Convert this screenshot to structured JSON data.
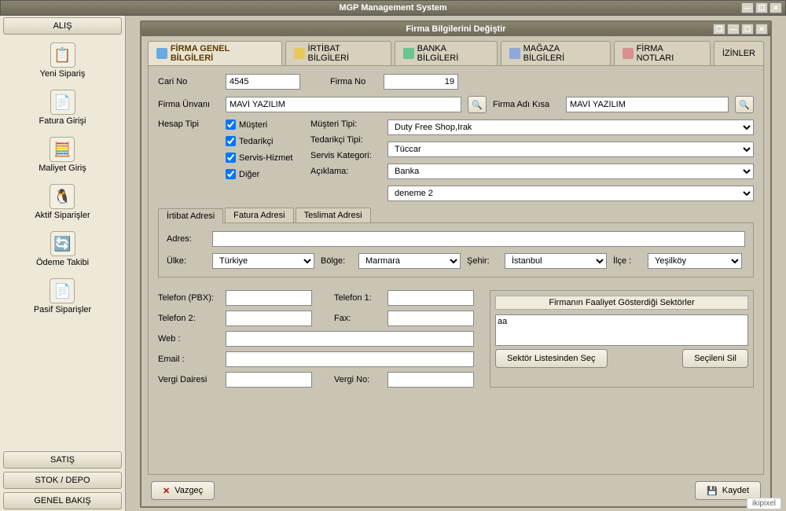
{
  "app": {
    "title": "MGP Management System"
  },
  "sidebar": {
    "sections": [
      "ALIŞ",
      "SATIŞ",
      "STOK / DEPO",
      "GENEL BAKIŞ"
    ],
    "items": [
      {
        "icon": "📋",
        "label": "Yeni Sipariş"
      },
      {
        "icon": "📄",
        "label": "Fatura Girişi"
      },
      {
        "icon": "🧮",
        "label": "Maliyet Giriş"
      },
      {
        "icon": "🐧",
        "label": "Aktif Siparişler"
      },
      {
        "icon": "🔄",
        "label": "Ödeme Takibi"
      },
      {
        "icon": "📄",
        "label": "Pasif Siparişler"
      }
    ]
  },
  "dialog": {
    "title": "Firma Bilgilerini Değiştir",
    "tabs": [
      "FİRMA GENEL BİLGİLERİ",
      "İRTİBAT BİLGİLERİ",
      "BANKA BİLGİLERİ",
      "MAĞAZA BİLGİLERİ",
      "FİRMA NOTLARI",
      "İZİNLER"
    ],
    "cari_no_label": "Cari No",
    "cari_no": "4545",
    "firma_no_label": "Firma No",
    "firma_no": "19",
    "firma_unvani_label": "Firma Ünvanı",
    "firma_unvani": "MAVİ YAZILIM",
    "firma_adi_kisa_label": "Firma Adı Kısa",
    "firma_adi_kisa": "MAVİ YAZILIM",
    "hesap_tipi_label": "Hesap Tipi",
    "chk_musteri": "Müşteri",
    "chk_tedarikci": "Tedarikçi",
    "chk_servis": "Servis-Hizmet",
    "chk_diger": "Diğer",
    "musteri_tipi_label": "Müşteri Tipi:",
    "musteri_tipi": "Duty Free Shop,Irak",
    "tedarikci_tipi_label": "Tedarikçi Tipi:",
    "tedarikci_tipi": "Tüccar",
    "servis_kategori_label": "Servis Kategori:",
    "servis_kategori": "Banka",
    "aciklama_label": "Açıklama:",
    "aciklama": "deneme 2",
    "subtabs": [
      "İrtibat Adresi",
      "Fatura Adresi",
      "Teslimat Adresi"
    ],
    "adres_label": "Adres:",
    "adres": "",
    "ulke_label": "Ülke:",
    "ulke": "Türkiye",
    "bolge_label": "Bölge:",
    "bolge": "Marmara",
    "sehir_label": "Şehir:",
    "sehir": "İstanbul",
    "ilce_label": "İlçe :",
    "ilce": "Yeşilköy",
    "tel_pbx_label": "Telefon (PBX):",
    "tel_pbx": "",
    "tel1_label": "Telefon 1:",
    "tel1": "",
    "tel2_label": "Telefon 2:",
    "tel2": "",
    "fax_label": "Fax:",
    "fax": "",
    "web_label": "Web :",
    "web": "",
    "email_label": "Email :",
    "email": "",
    "vergi_dairesi_label": "Vergi Dairesi",
    "vergi_dairesi": "",
    "vergi_no_label": "Vergi No:",
    "vergi_no": "",
    "sektor_header": "Firmanın Faaliyet Gösterdiği Sektörler",
    "sektor_item": "aa",
    "sektor_sec_btn": "Sektör Listesinden Seç",
    "secileni_sil_btn": "Seçileni Sil",
    "vazgec_btn": "Vazgeç",
    "kaydet_btn": "Kaydet"
  },
  "watermark": "ikipixel"
}
